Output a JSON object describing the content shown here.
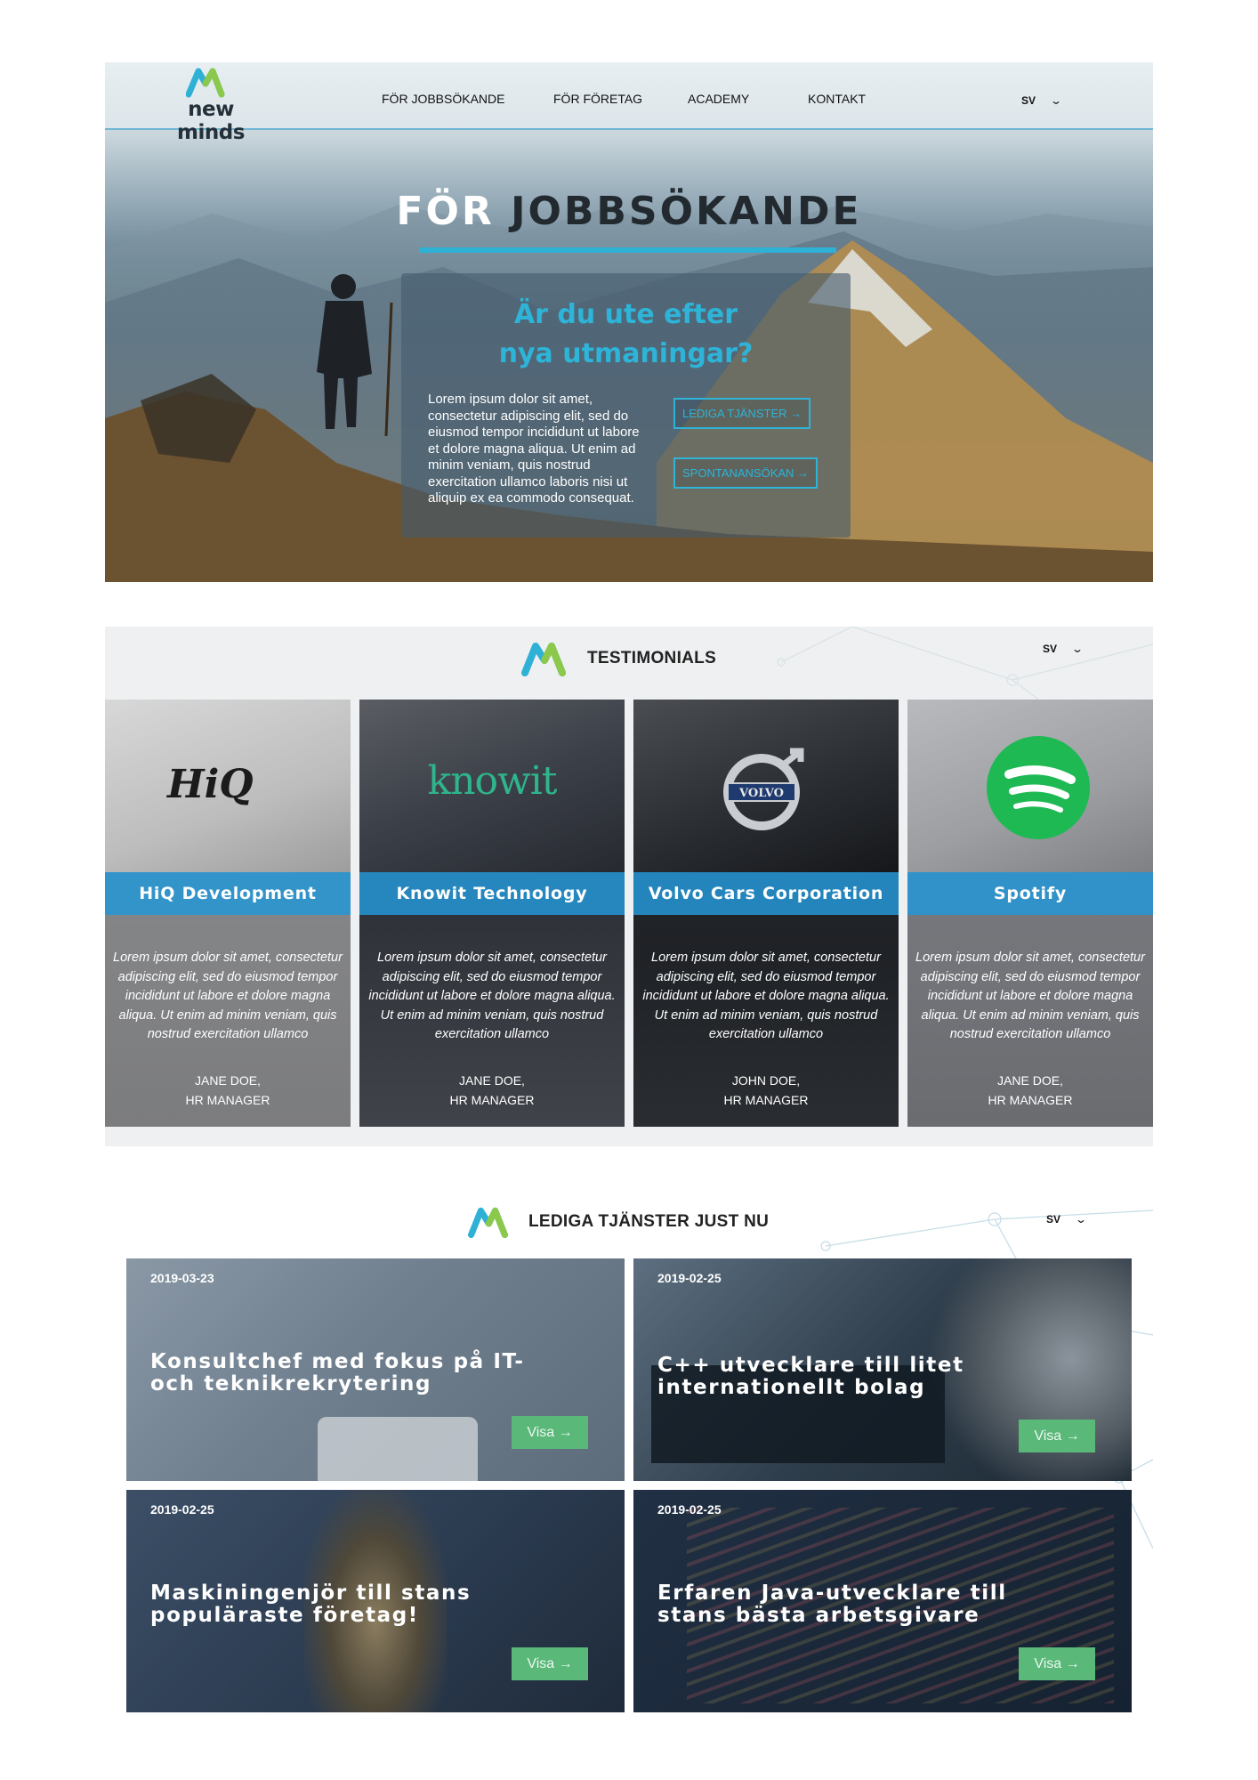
{
  "hero": {
    "logo_text": "new minds",
    "nav": [
      "FÖR JOBBSÖKANDE",
      "FÖR FÖRETAG",
      "ACADEMY",
      "KONTAKT"
    ],
    "lang": "SV",
    "title_part1": "FÖR",
    "title_part2": "JOBBSÖKANDE",
    "panel_heading_line1": "Är du ute efter",
    "panel_heading_line2": "nya utmaningar?",
    "panel_text": "Lorem ipsum dolor sit amet, consectetur adipiscing elit, sed do eiusmod tempor incididunt ut labore et dolore magna aliqua. Ut enim ad minim veniam, quis nostrud exercitation ullamco laboris nisi ut aliquip ex ea commodo consequat.",
    "btn_jobs": "LEDIGA TJÄNSTER →",
    "btn_spontaneous": "SPONTANANSÖKAN →"
  },
  "testimonials": {
    "title": "TESTIMONIALS",
    "lang": "SV",
    "cards": [
      {
        "logo": "HiQ",
        "name": "HiQ Development",
        "quote": "Lorem ipsum dolor sit amet, consectetur adipiscing elit, sed do eiusmod tempor incididunt ut labore et dolore magna aliqua. Ut enim ad minim veniam, quis nostrud exercitation ullamco",
        "person": "JANE DOE,",
        "role": "HR MANAGER"
      },
      {
        "logo": "knowit",
        "name": "Knowit Technology",
        "quote": "Lorem ipsum dolor sit amet, consectetur adipiscing elit, sed do eiusmod tempor incididunt ut labore et dolore magna aliqua. Ut enim ad minim veniam, quis nostrud exercitation ullamco",
        "person": "JANE DOE,",
        "role": "HR MANAGER"
      },
      {
        "logo": "VOLVO",
        "name": "Volvo Cars Corporation",
        "quote": "Lorem ipsum dolor sit amet, consectetur adipiscing elit, sed do eiusmod tempor incididunt ut labore et dolore magna aliqua. Ut enim ad minim veniam, quis nostrud exercitation ullamco",
        "person": "JOHN DOE,",
        "role": "HR MANAGER"
      },
      {
        "logo": "spotify-logo",
        "name": "Spotify",
        "quote": "Lorem ipsum dolor sit amet, consectetur adipiscing elit, sed do eiusmod tempor incididunt ut labore et dolore magna aliqua. Ut enim ad minim veniam, quis nostrud exercitation ullamco",
        "person": "JANE DOE,",
        "role": "HR MANAGER"
      }
    ]
  },
  "jobs": {
    "title": "LEDIGA TJÄNSTER JUST NU",
    "lang": "SV",
    "items": [
      {
        "date": "2019-03-23",
        "title": "Konsultchef med fokus på IT- och teknikrekrytering",
        "button": "Visa →"
      },
      {
        "date": "2019-02-25",
        "title": "C++ utvecklare till litet internationellt bolag",
        "button": "Visa →"
      },
      {
        "date": "2019-02-25",
        "title": "Maskiningenjör till stans populäraste företag!",
        "button": "Visa →"
      },
      {
        "date": "2019-02-25",
        "title": "Erfaren Java-utvecklare till stans bästa arbetsgivare",
        "button": "Visa →"
      }
    ]
  },
  "colors": {
    "accent_cyan": "#2db4d8",
    "brand_blue": "#2596d6",
    "visa_green": "#5ab879"
  }
}
